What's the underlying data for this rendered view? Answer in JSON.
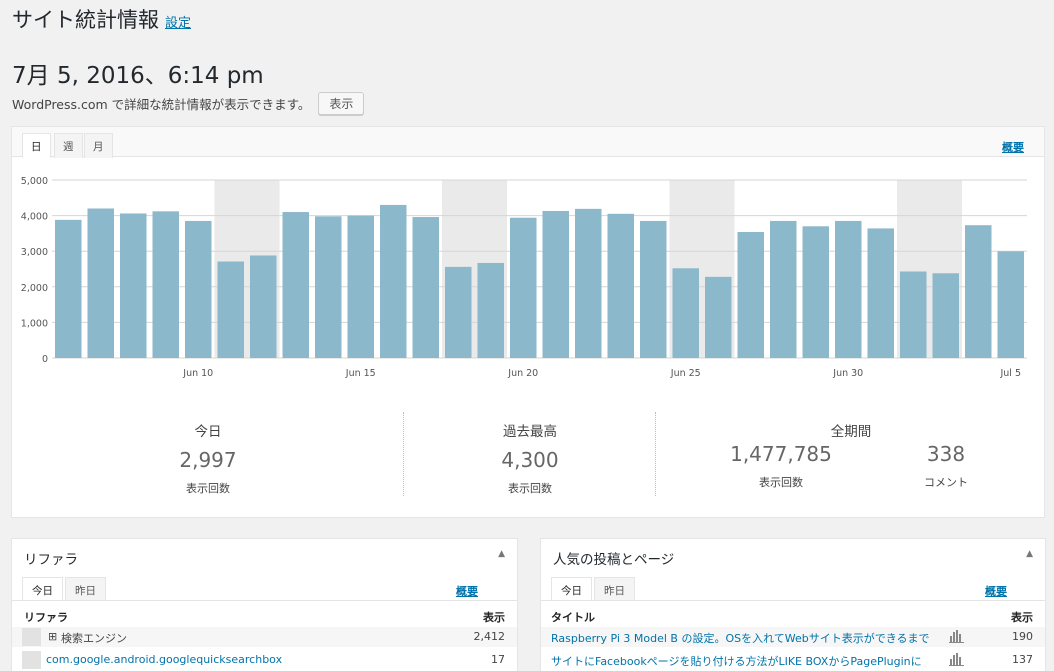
{
  "header": {
    "title": "サイト統計情報",
    "settings_link": "設定"
  },
  "date_heading": "7月 5, 2016、6:14 pm",
  "notice": {
    "text": "WordPress.com で詳細な統計情報が表示できます。",
    "button": "表示"
  },
  "stats": {
    "tabs": [
      "日",
      "週",
      "月"
    ],
    "summary_link": "概要",
    "kpis": {
      "today": {
        "title": "今日",
        "value": "2,997",
        "unit": "表示回数"
      },
      "best": {
        "title": "過去最高",
        "value": "4,300",
        "unit": "表示回数"
      },
      "all_time": {
        "title": "全期間",
        "views": "1,477,785",
        "views_unit": "表示回数",
        "comments": "338",
        "comments_unit": "コメント"
      }
    }
  },
  "chart_data": {
    "type": "bar",
    "x_tick_labels": [
      "Jun 10",
      "Jun 15",
      "Jun 20",
      "Jun 25",
      "Jun 30",
      "Jul 5"
    ],
    "y_tick_labels": [
      "5,000",
      "4,000",
      "3,000",
      "2,000",
      "1,000",
      "0"
    ],
    "ylim": [
      0,
      5000
    ],
    "categories": [
      "Jun 6",
      "Jun 7",
      "Jun 8",
      "Jun 9",
      "Jun 10",
      "Jun 11",
      "Jun 12",
      "Jun 13",
      "Jun 14",
      "Jun 15",
      "Jun 16",
      "Jun 17",
      "Jun 18",
      "Jun 19",
      "Jun 20",
      "Jun 21",
      "Jun 22",
      "Jun 23",
      "Jun 24",
      "Jun 25",
      "Jun 26",
      "Jun 27",
      "Jun 28",
      "Jun 29",
      "Jun 30",
      "Jul 1",
      "Jul 2",
      "Jul 3",
      "Jul 4",
      "Jul 5"
    ],
    "values": [
      3880,
      4200,
      4060,
      4120,
      3850,
      2710,
      2880,
      4100,
      3980,
      4000,
      4300,
      3960,
      2560,
      2670,
      3940,
      4130,
      4190,
      4050,
      3850,
      2520,
      2280,
      3540,
      3850,
      3700,
      3850,
      3640,
      2430,
      2380,
      3730,
      2997
    ],
    "weekend_highlight": [
      false,
      false,
      false,
      false,
      false,
      true,
      true,
      false,
      false,
      false,
      false,
      false,
      true,
      true,
      false,
      false,
      false,
      false,
      false,
      true,
      true,
      false,
      false,
      false,
      false,
      false,
      true,
      true,
      false,
      false
    ],
    "bar_color": "#8cb8cb",
    "grid": true
  },
  "referrers": {
    "title": "リファラ",
    "tabs": [
      "今日",
      "昨日"
    ],
    "summary_link": "概要",
    "col_source": "リファラ",
    "col_views": "表示",
    "rows": [
      {
        "label": "検索エンジン",
        "prefix": "⊞",
        "views": "2,412",
        "link": false
      },
      {
        "label": "com.google.android.googlequicksearchbox",
        "views": "17",
        "link": true
      }
    ]
  },
  "popular": {
    "title": "人気の投稿とページ",
    "tabs": [
      "今日",
      "昨日"
    ],
    "summary_link": "概要",
    "col_title": "タイトル",
    "col_views": "表示",
    "rows": [
      {
        "label": "Raspberry Pi 3 Model B の設定。OSを入れてWebサイト表示ができるまで",
        "views": "190"
      },
      {
        "label": "サイトにFacebookページを貼り付ける方法がLIKE BOXからPagePluginに",
        "views": "137"
      }
    ]
  }
}
